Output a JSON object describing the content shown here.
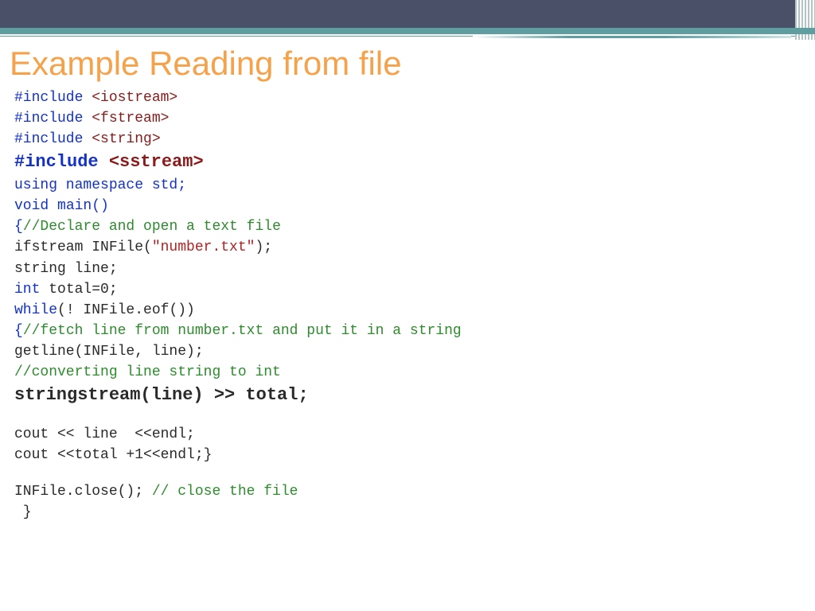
{
  "title": "Example Reading from  file",
  "code": {
    "inc1": {
      "pp": "#include ",
      "hdr": "<iostream>"
    },
    "inc2": {
      "pp": "#include ",
      "hdr": "<fstream>"
    },
    "inc3": {
      "pp": "#include ",
      "hdr": "<string>"
    },
    "inc4": {
      "pp": "#include ",
      "hdr": "<sstream>"
    },
    "using": {
      "kw": "using namespace ",
      "blk": "std;"
    },
    "main": {
      "kw": "void ",
      "blk": "main()"
    },
    "open": {
      "brace": "{",
      "cmt": "//Declare and open a text file"
    },
    "ifstr": {
      "blk1": "ifstream INFile(",
      "str": "\"number.txt\"",
      "blk2": ");"
    },
    "strln": "string line;",
    "intln": {
      "kw": "int ",
      "blk": "total=0;"
    },
    "whln": {
      "kw": "while",
      "blk": "(! INFile.eof())"
    },
    "fetch": {
      "brace": "{",
      "cmt": "//fetch line from number.txt and put it in a string"
    },
    "getln": "getline(INFile, line);",
    "convc": "//converting line string to int",
    "sstr": "stringstream(line) >> total;",
    "cout1": "cout << line  <<endl;",
    "cout2": "cout <<total +1<<endl;}",
    "close": {
      "blk": "INFile.close(); ",
      "cmt": "// close the file"
    },
    "end": " }"
  }
}
